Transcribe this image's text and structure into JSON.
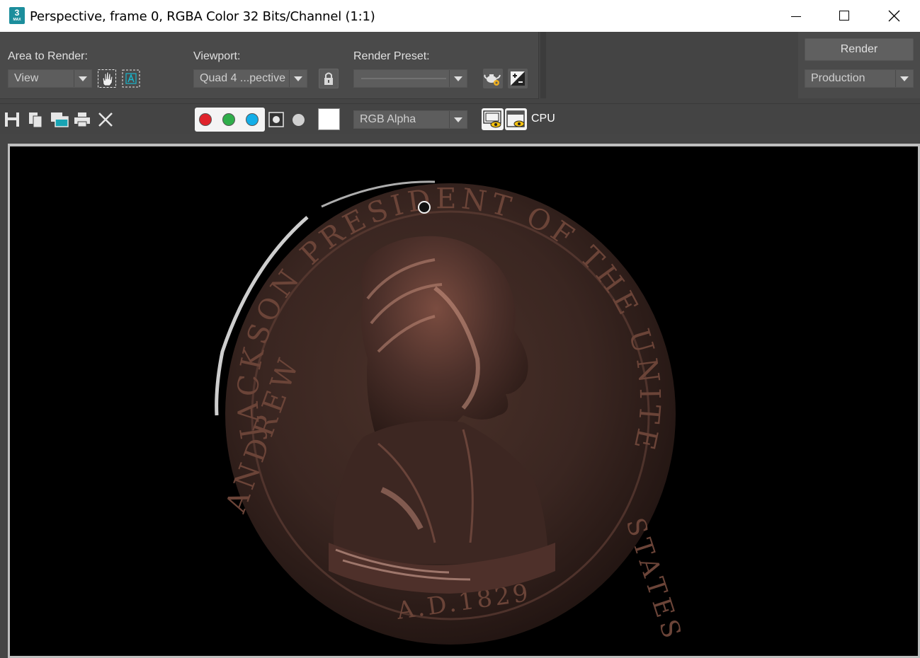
{
  "window": {
    "app_icon_number": "3",
    "app_icon_sub": "MAX",
    "title": "Perspective, frame 0, RGBA Color 32 Bits/Channel (1:1)",
    "controls": [
      "minimize-icon",
      "maximize-icon",
      "close-icon"
    ]
  },
  "render_setup": {
    "area_label": "Area to Render:",
    "area_value": "View",
    "viewport_label": "Viewport:",
    "viewport_value": "Quad 4 ...pective",
    "preset_label": "Render Preset:",
    "preset_value": "",
    "render_button": "Render",
    "production_value": "Production"
  },
  "toolbar": {
    "channel_display": "RGB Alpha",
    "renderer": "CPU",
    "channels": [
      {
        "name": "red",
        "color": "#e0232b",
        "enabled": true
      },
      {
        "name": "green",
        "color": "#2fae4a",
        "enabled": true
      },
      {
        "name": "blue",
        "color": "#12aee8",
        "enabled": true
      }
    ],
    "swatch_color": "#ffffff"
  },
  "render_image": {
    "subject": "bronze coin",
    "inscription_top": "JACKSON PRESIDENT OF THE UNITED",
    "inscription_bottom": "A.D.1829",
    "inscription_left": "ANDREW",
    "inscription_right": "STATES",
    "colors": {
      "metal": "#5a3a32",
      "highlight": "#d8a08c",
      "background": "#000000"
    }
  }
}
